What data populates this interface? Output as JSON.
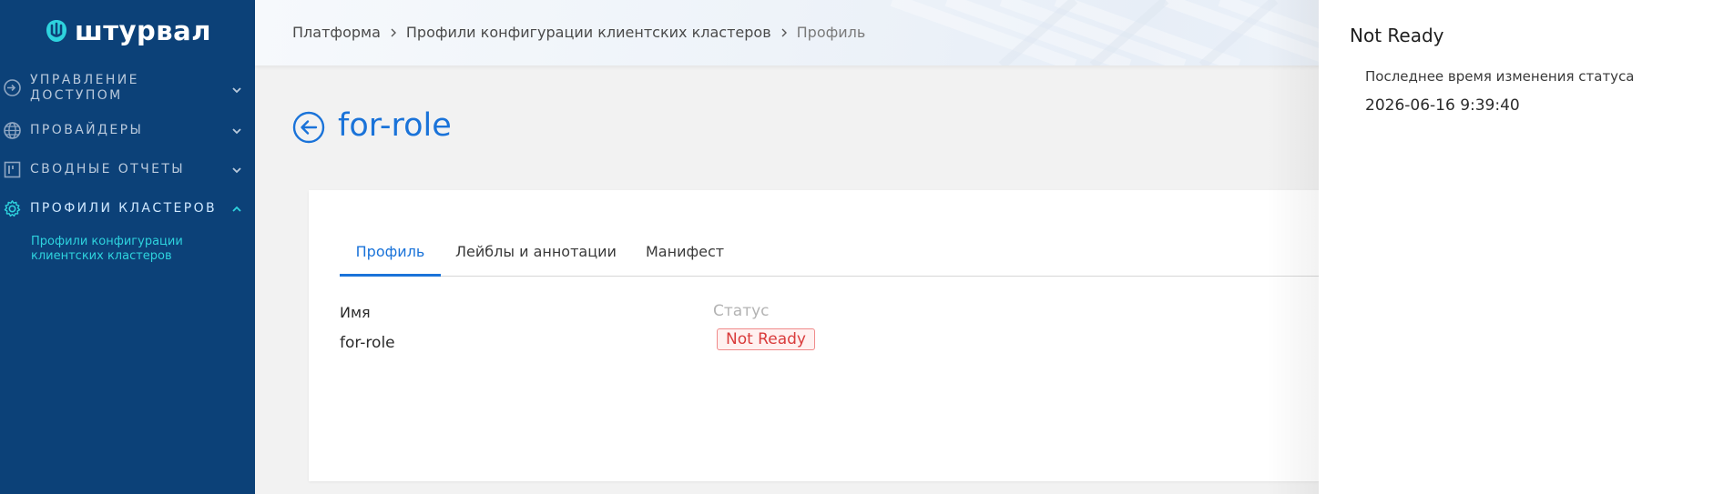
{
  "app": {
    "logo_text": "штурвал"
  },
  "sidebar": {
    "items": [
      {
        "label_line1": "УПРАВЛЕНИЕ",
        "label_line2": "ДОСТУПОМ",
        "icon": "access-icon"
      },
      {
        "label": "ПРОВАЙДЕРЫ",
        "icon": "globe-icon"
      },
      {
        "label": "СВОДНЫЕ ОТЧЕТЫ",
        "icon": "board-icon"
      },
      {
        "label": "ПРОФИЛИ КЛАСТЕРОВ",
        "icon": "gear-icon"
      }
    ],
    "sub_item_line1": "Профили конфигурации",
    "sub_item_line2": "клиентских кластеров"
  },
  "breadcrumb": {
    "items": [
      "Платформа",
      "Профили конфигурации клиентских кластеров",
      "Профиль"
    ]
  },
  "page": {
    "title": "for-role"
  },
  "tabs": [
    "Профиль",
    "Лейблы и аннотации",
    "Манифест"
  ],
  "profile": {
    "name_label": "Имя",
    "name_value": "for-role",
    "status_label": "Статус",
    "status_value": "Not Ready"
  },
  "drawer": {
    "title": "Not Ready",
    "label": "Последнее время изменения статуса",
    "value": "2026-06-16 9:39:40"
  },
  "colors": {
    "sidebar_bg": "#0c4178",
    "accent": "#1a73d9",
    "sub_item": "#2ed3de",
    "status_error": "#d93b3b"
  }
}
